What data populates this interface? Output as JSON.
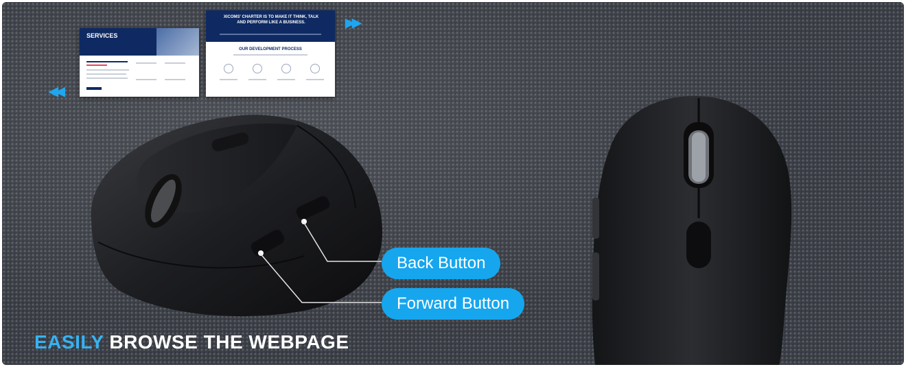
{
  "thumbnails": {
    "services_title": "SERVICES",
    "process_header": "XICOMS' CHARTER IS TO MAKE IT THINK, TALK AND PERFORM LIKE A BUSINESS.",
    "process_title": "OUR DEVELOPMENT PROCESS"
  },
  "callouts": {
    "back_label": "Back Button",
    "forward_label": "Forward Button"
  },
  "headline": {
    "accent": "EASILY",
    "rest": "BROWSE THE WEBPAGE"
  },
  "colors": {
    "accent": "#16a6ee",
    "headline_accent": "#37b2f2",
    "background": "#3b3e45",
    "navy": "#0f2a62"
  },
  "icons": {
    "left_arrows": "double-chevron-left-icon",
    "right_arrows": "double-chevron-right-icon"
  }
}
